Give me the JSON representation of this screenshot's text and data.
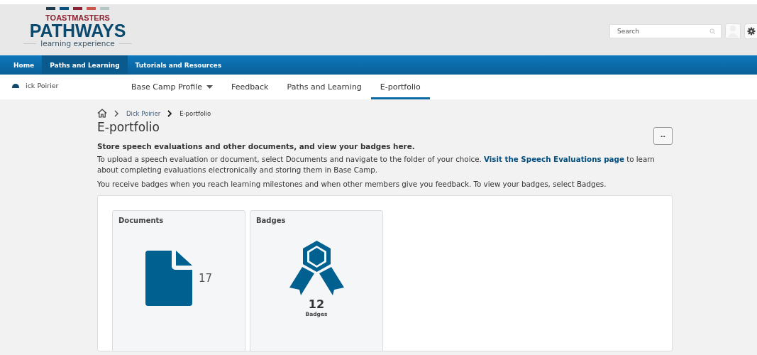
{
  "logo": {
    "top": "TOASTMASTERS",
    "main": "PATHWAYS",
    "sub": "learning experience",
    "stripes": [
      {
        "color": "#1d3d4f"
      },
      {
        "color": "#0b4f7c"
      },
      {
        "color": "#8c2332"
      },
      {
        "color": "#c9574b"
      },
      {
        "color": "#b4c6c4"
      }
    ]
  },
  "search": {
    "placeholder": "Search"
  },
  "nav": [
    {
      "label": "Home",
      "selected": false
    },
    {
      "label": "Paths and Learning",
      "selected": true
    },
    {
      "label": "Tutorials and Resources",
      "selected": false
    }
  ],
  "user": {
    "name": "ick Poirier"
  },
  "tabs": [
    {
      "label": "Base Camp Profile",
      "selected": false,
      "dropdown": true
    },
    {
      "label": "Feedback",
      "selected": false,
      "dropdown": false
    },
    {
      "label": "Paths and Learning",
      "selected": false,
      "dropdown": false
    },
    {
      "label": "E-portfolio",
      "selected": true,
      "dropdown": false
    }
  ],
  "breadcrumb": [
    "Dick Poirier",
    "E-portfolio"
  ],
  "page": {
    "title": "E-portfolio",
    "more": "•••",
    "lead": "Store speech evaluations and other documents, and view your badges here.",
    "p1_before": "To upload a speech evaluation or document, select Documents and navigate to the folder of your choice.",
    "p1_link": "Visit the Speech Evaluations page",
    "p1_after": "to learn about completing evaluations electronically and storing them in Base Camp.",
    "p2": "You receive badges when you reach learning milestones and when other members give you feedback. To view your badges, select Badges."
  },
  "tiles": [
    {
      "kind": "documents",
      "title": "Documents",
      "count": "17"
    },
    {
      "kind": "badges",
      "title": "Badges",
      "count": "12",
      "caption": "Badges"
    }
  ]
}
